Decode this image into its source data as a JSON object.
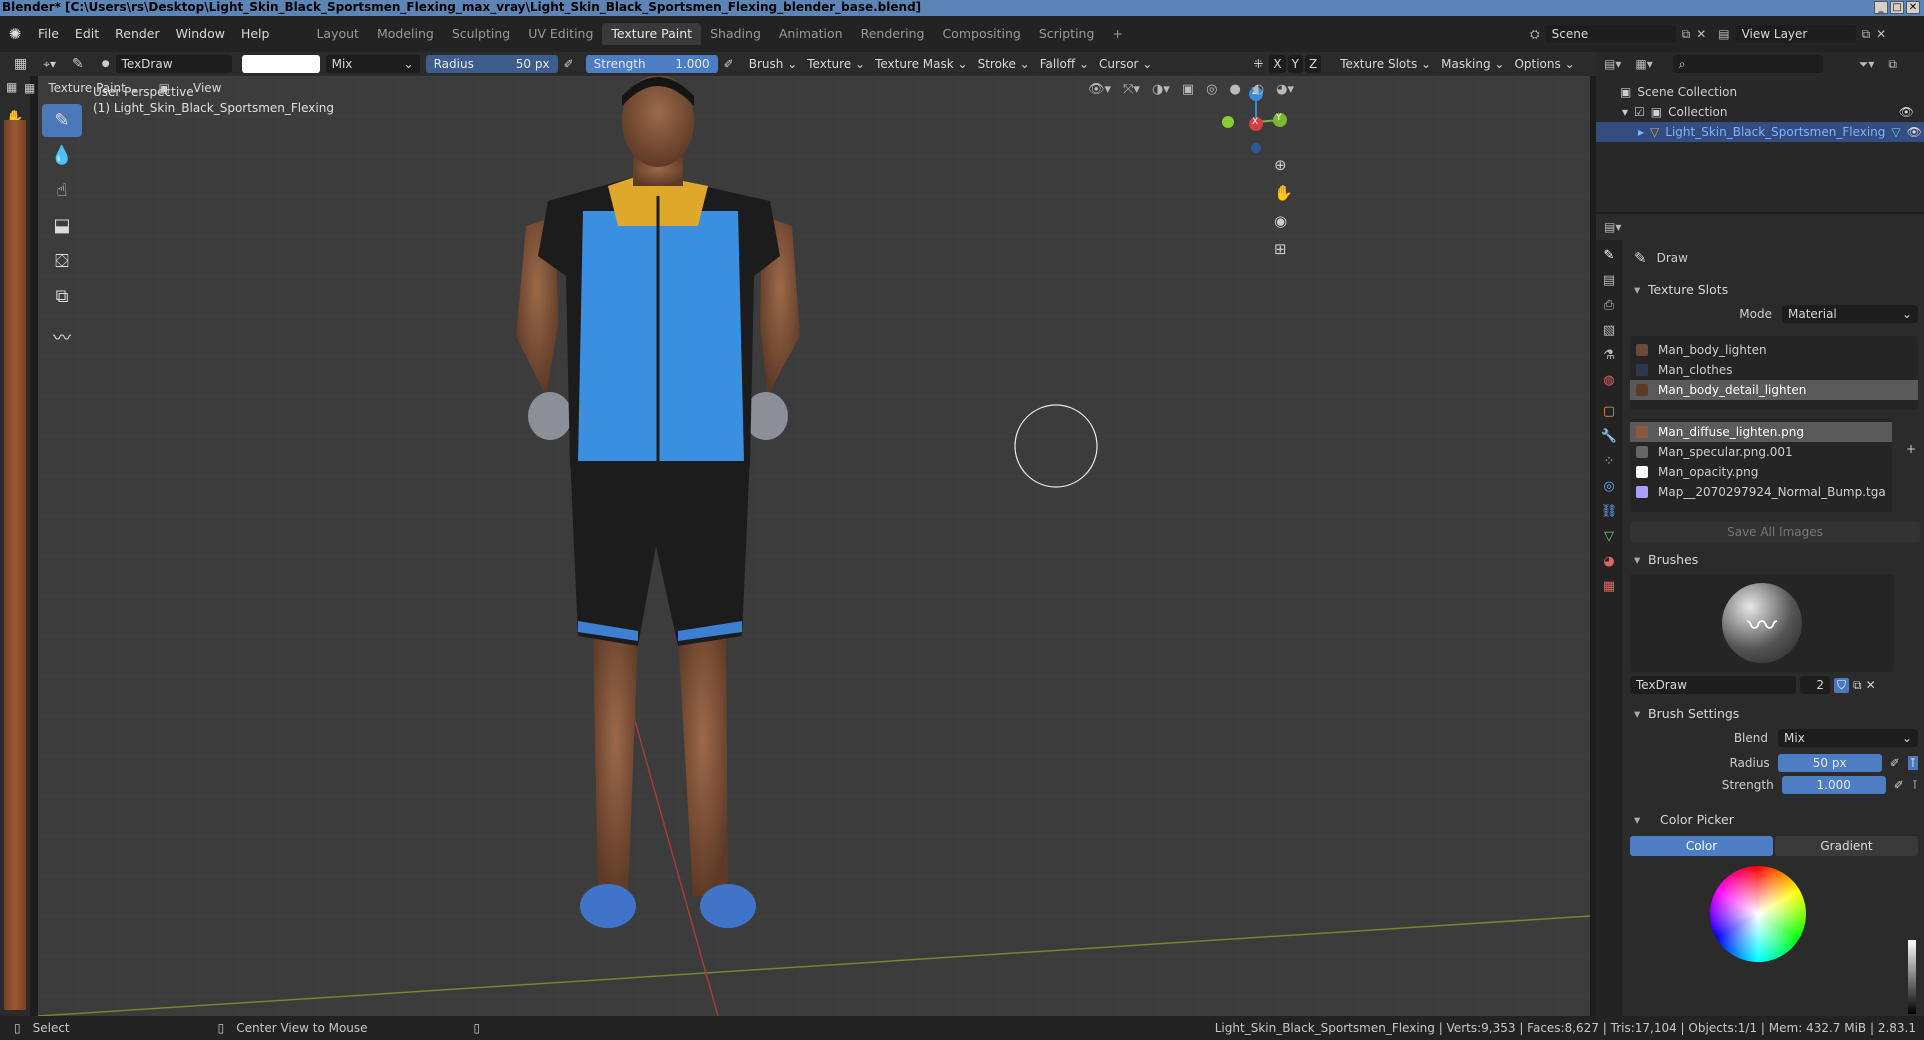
{
  "window": {
    "title": "Blender* [C:\\Users\\rs\\Desktop\\Light_Skin_Black_Sportsmen_Flexing_max_vray\\Light_Skin_Black_Sportsmen_Flexing_blender_base.blend]",
    "min": "_",
    "max": "□",
    "close": "✕"
  },
  "menu": [
    "File",
    "Edit",
    "Render",
    "Window",
    "Help"
  ],
  "workspaces": [
    {
      "label": "Layout"
    },
    {
      "label": "Modeling"
    },
    {
      "label": "Sculpting"
    },
    {
      "label": "UV Editing"
    },
    {
      "label": "Texture Paint",
      "active": true
    },
    {
      "label": "Shading"
    },
    {
      "label": "Animation"
    },
    {
      "label": "Rendering"
    },
    {
      "label": "Compositing"
    },
    {
      "label": "Scripting"
    }
  ],
  "add_workspace": "+",
  "scene": {
    "label": "Scene",
    "view_layer": "View Layer"
  },
  "toolbar": {
    "brush_name": "TexDraw",
    "blend": "Mix",
    "radius_label": "Radius",
    "radius_value": "50 px",
    "strength_label": "Strength",
    "strength_value": "1.000",
    "menus": [
      "Brush",
      "Texture",
      "Texture Mask",
      "Stroke",
      "Falloff",
      "Cursor"
    ],
    "axes": [
      "X",
      "Y",
      "Z"
    ],
    "right_menus": [
      "Texture Slots",
      "Masking",
      "Options"
    ]
  },
  "subheader": {
    "mode": "Texture Paint",
    "view": "View"
  },
  "viewport": {
    "line1": "User Perspective",
    "line2": "(1) Light_Skin_Black_Sportsmen_Flexing",
    "axis_x": "X",
    "axis_y": "Y",
    "axis_z": "Z"
  },
  "outliner": {
    "root": "Scene Collection",
    "collection": "Collection",
    "object": "Light_Skin_Black_Sportsmen_Flexing"
  },
  "properties": {
    "tool_name": "Draw",
    "texture_slots": {
      "title": "Texture Slots",
      "mode_label": "Mode",
      "mode_value": "Material",
      "materials": [
        {
          "name": "Man_body_lighten",
          "color": "#6b4a3a"
        },
        {
          "name": "Man_clothes",
          "color": "#2a3a4a"
        },
        {
          "name": "Man_body_detail_lighten",
          "color": "#5b3a2a",
          "selected": true
        }
      ],
      "images": [
        {
          "name": "Man_diffuse_lighten.png",
          "color": "#8a5a3a",
          "selected": true
        },
        {
          "name": "Man_specular.png.001",
          "color": "#666666"
        },
        {
          "name": "Man_opacity.png",
          "color": "#ffffff"
        },
        {
          "name": "Map__2070297924_Normal_Bump.tga",
          "color": "#a8a0ff"
        }
      ],
      "save_all": "Save All Images"
    },
    "brushes": {
      "title": "Brushes",
      "name": "TexDraw",
      "users": "2"
    },
    "brush_settings": {
      "title": "Brush Settings",
      "blend_label": "Blend",
      "blend_value": "Mix",
      "radius_label": "Radius",
      "radius_value": "50 px",
      "strength_label": "Strength",
      "strength_value": "1.000"
    },
    "color_picker": {
      "title": "Color Picker",
      "tab_color": "Color",
      "tab_gradient": "Gradient"
    }
  },
  "status": {
    "select": "Select",
    "center": "Center View to Mouse",
    "info": "Light_Skin_Black_Sportsmen_Flexing | Verts:9,353 | Faces:8,627 | Tris:17,104 | Objects:1/1 | Mem: 432.7 MiB | 2.83.1"
  },
  "colors": {
    "accent": "#4a78b8",
    "slider": "#4d7ec4",
    "titlebar": "#5c85b5",
    "x_axis": "#d04040",
    "y_axis": "#7bb832",
    "z_axis": "#3a8ad8"
  }
}
